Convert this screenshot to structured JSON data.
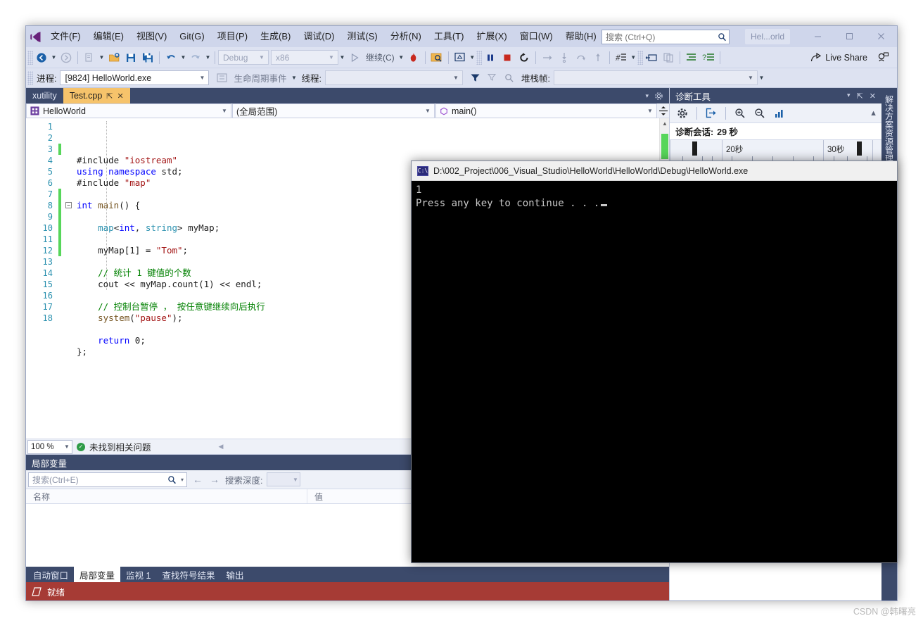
{
  "app": {
    "logo_icon": "visual-studio-logo-icon",
    "menu": [
      {
        "label": "文件(F)"
      },
      {
        "label": "编辑(E)"
      },
      {
        "label": "视图(V)"
      },
      {
        "label": "Git(G)"
      },
      {
        "label": "项目(P)"
      },
      {
        "label": "生成(B)"
      },
      {
        "label": "调试(D)"
      },
      {
        "label": "测试(S)"
      },
      {
        "label": "分析(N)"
      },
      {
        "label": "工具(T)"
      },
      {
        "label": "扩展(X)"
      },
      {
        "label": "窗口(W)"
      },
      {
        "label": "帮助(H)"
      }
    ],
    "search": {
      "placeholder": "搜索 (Ctrl+Q)",
      "value": "",
      "icon": "search-icon"
    },
    "account_chip": "Hel...orld",
    "window_buttons": {
      "minimize": "—",
      "maximize": "□",
      "close": "✕"
    }
  },
  "toolbar": {
    "back_label": "←",
    "forward_label": "→",
    "navigate_backward_icon": "navigate-backward-icon",
    "navigate_forward_icon": "navigate-forward-icon",
    "new_item_icon": "new-item-icon",
    "open_file_icon": "open-folder-icon",
    "save_icon": "save-icon",
    "save_all_icon": "save-all-icon",
    "undo_icon": "undo-icon",
    "redo_icon": "redo-icon",
    "config_combo": "Debug",
    "platform_combo": "x86",
    "continue_label": "继续(C)",
    "hot_reload_icon": "hot-reload-icon",
    "attach_icon": "attach-to-process-icon",
    "break_all_icon": "break-all-icon",
    "pause_icon": "pause-icon",
    "stop_icon": "stop-debugging-icon",
    "restart_icon": "restart-icon",
    "show_next_statement_icon": "show-next-statement-icon",
    "step_into_icon": "step-into-icon",
    "step_over_icon": "step-over-icon",
    "step_out_icon": "step-out-icon",
    "disassembly_icon": "disassembly-icon",
    "thread_window_icon": "thread-window-icon",
    "breakpoints_icon": "breakpoints-icon",
    "indent_icon": "indent-icon",
    "outdent_icon": "outdent-icon",
    "live_share_label": "Live Share",
    "live_share_icon": "live-share-icon",
    "feedback_icon": "feedback-icon"
  },
  "debugbar": {
    "process_label": "进程:",
    "process_value": "[9824] HelloWorld.exe",
    "lifecycle_icon": "lifecycle-events-icon",
    "lifecycle_label": "生命周期事件",
    "thread_label": "线程:",
    "thread_value": "",
    "filter_icon": "filter-icon",
    "flag_icon": "flag-icon",
    "stackframe_label": "堆栈帧:",
    "stackframe_value": ""
  },
  "editor": {
    "tabs": [
      {
        "label": "xutility",
        "active": false
      },
      {
        "label": "Test.cpp",
        "active": true,
        "pin": "⇱",
        "close": "✕"
      }
    ],
    "tabstrip_controls": {
      "dropdown": "▾",
      "settings_icon": "gear-icon"
    },
    "project_combo": {
      "label": "HelloWorld",
      "icon": "project-icon"
    },
    "scope_combo": "(全局范围)",
    "member_combo": "main()",
    "member_icon": "method-icon",
    "split_icon": "split-view-icon",
    "lines": [
      {
        "n": 1,
        "changed": false,
        "html": "#include <span class=\"st\">\"iostream\"</span>",
        "indent": 0
      },
      {
        "n": 2,
        "changed": false,
        "html": "<span class=\"k1\">using</span> <span class=\"k1\">namespace</span> std;",
        "indent": 0
      },
      {
        "n": 3,
        "changed": true,
        "html": "#include <span class=\"st\">\"map\"</span>",
        "indent": 0
      },
      {
        "n": 4,
        "changed": false,
        "html": "",
        "indent": 0
      },
      {
        "n": 5,
        "changed": false,
        "html": "<span class=\"k1\">int</span> <span class=\"fn\">main</span>() {",
        "indent": 0,
        "fold": true
      },
      {
        "n": 6,
        "changed": false,
        "html": "",
        "indent": 0
      },
      {
        "n": 7,
        "changed": true,
        "html": "    <span class=\"k2\">map</span>&lt;<span class=\"k1\">int</span>, <span class=\"k2\">string</span>&gt; myMap;",
        "indent": 0
      },
      {
        "n": 8,
        "changed": true,
        "html": "",
        "indent": 0
      },
      {
        "n": 9,
        "changed": true,
        "html": "    myMap[1] = <span class=\"st\">\"Tom\"</span>;",
        "indent": 0
      },
      {
        "n": 10,
        "changed": true,
        "html": "",
        "indent": 0
      },
      {
        "n": 11,
        "changed": true,
        "html": "    <span class=\"cm\">// 统计 1 键值的个数</span>",
        "indent": 0
      },
      {
        "n": 12,
        "changed": true,
        "html": "    cout &lt;&lt; myMap.count(1) &lt;&lt; endl;",
        "indent": 0
      },
      {
        "n": 13,
        "changed": false,
        "html": "",
        "indent": 0
      },
      {
        "n": 14,
        "changed": false,
        "html": "    <span class=\"cm\">// 控制台暂停 ， 按任意键继续向后执行</span>",
        "indent": 0
      },
      {
        "n": 15,
        "changed": false,
        "html": "    <span class=\"fn\">system</span>(<span class=\"st\">\"pause\"</span>);",
        "indent": 0
      },
      {
        "n": 16,
        "changed": false,
        "html": "",
        "indent": 0
      },
      {
        "n": 17,
        "changed": false,
        "html": "    <span class=\"k1\">return</span> 0;",
        "indent": 0
      },
      {
        "n": 18,
        "changed": false,
        "html": "};",
        "indent": 0
      }
    ],
    "status": {
      "zoom": "100 %",
      "issues": "未找到相关问题",
      "ok_icon": "checkmark-icon"
    }
  },
  "locals": {
    "title": "局部变量",
    "header_controls": {
      "close": "✕"
    },
    "search_placeholder": "搜索(Ctrl+E)",
    "search_icon": "search-icon",
    "search_dropdown": "▾",
    "prev_icon": "arrow-left-icon",
    "next_icon": "arrow-right-icon",
    "depth_label": "搜索深度:",
    "depth_value": "",
    "columns": [
      "名称",
      "值"
    ],
    "rows": []
  },
  "dock_tabs": [
    {
      "label": "自动窗口",
      "active": false
    },
    {
      "label": "局部变量",
      "active": true
    },
    {
      "label": "监视 1",
      "active": false
    },
    {
      "label": "查找符号结果",
      "active": false
    },
    {
      "label": "输出",
      "active": false
    }
  ],
  "statusbar": {
    "icon": "ready-icon",
    "text": "就绪"
  },
  "diagnostics": {
    "title": "诊断工具",
    "header_controls": {
      "dropdown": "▾",
      "pin": "⇱",
      "close": "✕"
    },
    "tools": {
      "settings_icon": "gear-icon",
      "export_icon": "export-icon",
      "zoom_in_icon": "zoom-in-icon",
      "zoom_out_icon": "zoom-out-icon",
      "analyze_icon": "analyze-chart-icon",
      "scroll_up_icon": "scroll-up-icon"
    },
    "session_label": "诊断会话:",
    "session_value": "29 秒",
    "timeline_labels": [
      "20秒",
      "30秒"
    ]
  },
  "side_strip": {
    "vertical_tab": "解决方案资源管理器"
  },
  "console": {
    "icon": "console-icon",
    "title": "D:\\002_Project\\006_Visual_Studio\\HelloWorld\\HelloWorld\\Debug\\HelloWorld.exe",
    "output_line1": "1",
    "output_line2": "Press any key to continue . . ."
  },
  "watermark": "CSDN @韩曙亮"
}
